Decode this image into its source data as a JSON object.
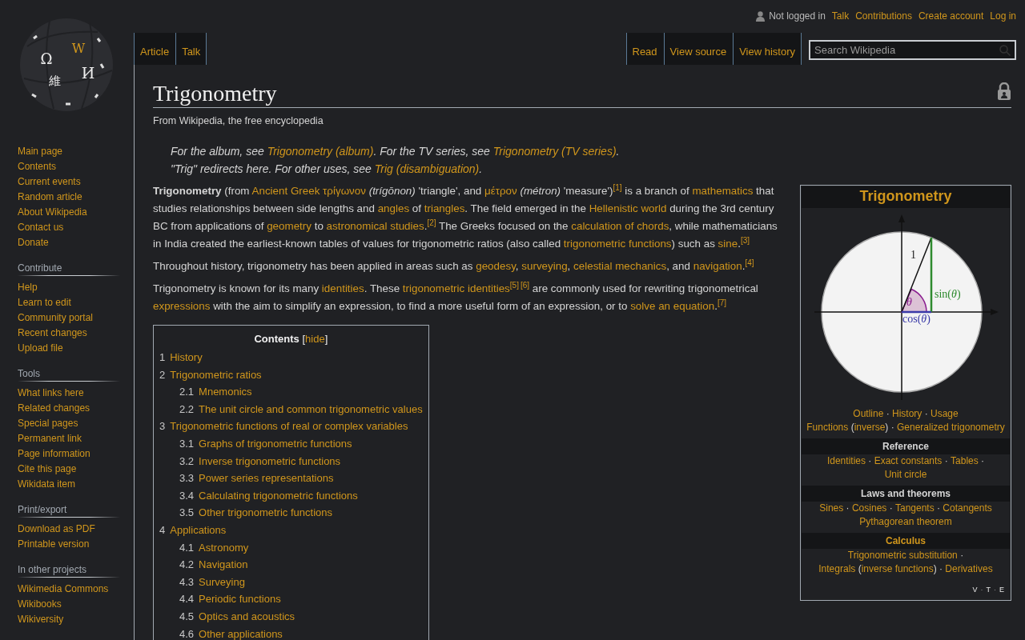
{
  "logo": {
    "glyphs": [
      "W",
      "Ω",
      "維",
      "И"
    ]
  },
  "personal": {
    "status": "Not logged in",
    "links": [
      "Talk",
      "Contributions",
      "Create account",
      "Log in"
    ]
  },
  "sidebar": [
    {
      "items": [
        "Main page",
        "Contents",
        "Current events",
        "Random article",
        "About Wikipedia",
        "Contact us",
        "Donate"
      ]
    },
    {
      "heading": "Contribute",
      "items": [
        "Help",
        "Learn to edit",
        "Community portal",
        "Recent changes",
        "Upload file"
      ]
    },
    {
      "heading": "Tools",
      "items": [
        "What links here",
        "Related changes",
        "Special pages",
        "Permanent link",
        "Page information",
        "Cite this page",
        "Wikidata item"
      ]
    },
    {
      "heading": "Print/export",
      "items": [
        "Download as PDF",
        "Printable version"
      ]
    },
    {
      "heading": "In other projects",
      "items": [
        "Wikimedia Commons",
        "Wikibooks",
        "Wikiversity"
      ]
    }
  ],
  "left_tabs": [
    "Article",
    "Talk"
  ],
  "right_tabs": [
    "Read",
    "View source",
    "View history"
  ],
  "search": {
    "placeholder": "Search Wikipedia"
  },
  "title": "Trigonometry",
  "tagline": "From Wikipedia, the free encyclopedia",
  "hatnotes": [
    [
      {
        "kind": "text",
        "text": "For the album, see "
      },
      {
        "kind": "link",
        "text": "Trigonometry (album)"
      },
      {
        "kind": "text",
        "text": ". For the TV series, see "
      },
      {
        "kind": "link",
        "text": "Trigonometry (TV series)"
      },
      {
        "kind": "text",
        "text": "."
      }
    ],
    [
      {
        "kind": "text",
        "text": "\"Trig\" redirects here. For other uses, see "
      },
      {
        "kind": "link",
        "text": "Trig (disambiguation)"
      },
      {
        "kind": "text",
        "text": "."
      }
    ]
  ],
  "paragraphs": [
    [
      {
        "kind": "bold",
        "text": "Trigonometry"
      },
      {
        "kind": "text",
        "text": " (from "
      },
      {
        "kind": "link",
        "text": "Ancient Greek τρίγωνον"
      },
      {
        "kind": "italic",
        "text": " (trígōnon)"
      },
      {
        "kind": "text",
        "text": " 'triangle', and "
      },
      {
        "kind": "link",
        "text": "μέτρον"
      },
      {
        "kind": "italic",
        "text": " (métron)"
      },
      {
        "kind": "text",
        "text": " 'measure')"
      },
      {
        "kind": "ref",
        "text": "[1]"
      },
      {
        "kind": "text",
        "text": " is a branch of "
      },
      {
        "kind": "link",
        "text": "mathematics"
      },
      {
        "kind": "text",
        "text": " that studies relationships between side lengths and "
      },
      {
        "kind": "link",
        "text": "angles"
      },
      {
        "kind": "text",
        "text": " of "
      },
      {
        "kind": "link",
        "text": "triangles"
      },
      {
        "kind": "text",
        "text": ". The field emerged in the "
      },
      {
        "kind": "link",
        "text": "Hellenistic world"
      },
      {
        "kind": "text",
        "text": " during the 3rd century BC from applications of "
      },
      {
        "kind": "link",
        "text": "geometry"
      },
      {
        "kind": "text",
        "text": " to "
      },
      {
        "kind": "link",
        "text": "astronomical studies"
      },
      {
        "kind": "text",
        "text": "."
      },
      {
        "kind": "ref",
        "text": "[2]"
      },
      {
        "kind": "text",
        "text": " The Greeks focused on the "
      },
      {
        "kind": "link",
        "text": "calculation of chords"
      },
      {
        "kind": "text",
        "text": ", while mathematicians in India created the earliest-known tables of values for trigonometric ratios (also called "
      },
      {
        "kind": "link",
        "text": "trigonometric functions"
      },
      {
        "kind": "text",
        "text": ") such as "
      },
      {
        "kind": "link",
        "text": "sine"
      },
      {
        "kind": "text",
        "text": "."
      },
      {
        "kind": "ref",
        "text": "[3]"
      }
    ],
    [
      {
        "kind": "text",
        "text": "Throughout history, trigonometry has been applied in areas such as "
      },
      {
        "kind": "link",
        "text": "geodesy"
      },
      {
        "kind": "text",
        "text": ", "
      },
      {
        "kind": "link",
        "text": "surveying"
      },
      {
        "kind": "text",
        "text": ", "
      },
      {
        "kind": "link",
        "text": "celestial mechanics"
      },
      {
        "kind": "text",
        "text": ", and "
      },
      {
        "kind": "link",
        "text": "navigation"
      },
      {
        "kind": "text",
        "text": "."
      },
      {
        "kind": "ref",
        "text": "[4]"
      }
    ],
    [
      {
        "kind": "text",
        "text": "Trigonometry is known for its many "
      },
      {
        "kind": "link",
        "text": "identities"
      },
      {
        "kind": "text",
        "text": ". These "
      },
      {
        "kind": "link",
        "text": "trigonometric identities"
      },
      {
        "kind": "ref",
        "text": "[5]"
      },
      {
        "kind": "ref",
        "text": "[6]"
      },
      {
        "kind": "text",
        "text": " are commonly used for rewriting trigonometrical "
      },
      {
        "kind": "link",
        "text": "expressions"
      },
      {
        "kind": "text",
        "text": " with the aim to simplify an expression, to find a more useful form of an expression, or to "
      },
      {
        "kind": "link",
        "text": "solve an equation"
      },
      {
        "kind": "text",
        "text": "."
      },
      {
        "kind": "ref",
        "text": "[7]"
      }
    ]
  ],
  "toc": {
    "title": "Contents",
    "toggle": {
      "before": "[",
      "label": "hide",
      "after": "]"
    },
    "items": [
      {
        "number": "1",
        "label": "History"
      },
      {
        "number": "2",
        "label": "Trigonometric ratios",
        "children": [
          {
            "number": "2.1",
            "label": "Mnemonics"
          },
          {
            "number": "2.2",
            "label": "The unit circle and common trigonometric values"
          }
        ]
      },
      {
        "number": "3",
        "label": "Trigonometric functions of real or complex variables",
        "children": [
          {
            "number": "3.1",
            "label": "Graphs of trigonometric functions"
          },
          {
            "number": "3.2",
            "label": "Inverse trigonometric functions"
          },
          {
            "number": "3.3",
            "label": "Power series representations"
          },
          {
            "number": "3.4",
            "label": "Calculating trigonometric functions"
          },
          {
            "number": "3.5",
            "label": "Other trigonometric functions"
          }
        ]
      },
      {
        "number": "4",
        "label": "Applications",
        "children": [
          {
            "number": "4.1",
            "label": "Astronomy"
          },
          {
            "number": "4.2",
            "label": "Navigation"
          },
          {
            "number": "4.3",
            "label": "Surveying"
          },
          {
            "number": "4.4",
            "label": "Periodic functions"
          },
          {
            "number": "4.5",
            "label": "Optics and acoustics"
          },
          {
            "number": "4.6",
            "label": "Other applications"
          }
        ]
      }
    ]
  },
  "infobox": {
    "title": "Trigonometry",
    "diagram_labels": [
      {
        "kind": "radius",
        "text": "1"
      },
      {
        "kind": "angle",
        "text": "*θ*"
      },
      {
        "kind": "sine",
        "text": "sin(*θ*)"
      },
      {
        "kind": "cosine",
        "text": "cos(*θ*)"
      }
    ],
    "sections": [
      {
        "lines": [
          {
            "segments": [
              {
                "kind": "link",
                "text": "Outline"
              },
              {
                "kind": "text",
                "text": " · "
              },
              {
                "kind": "link",
                "text": "History"
              },
              {
                "kind": "text",
                "text": " · "
              },
              {
                "kind": "link",
                "text": "Usage"
              }
            ]
          },
          {
            "segments": [
              {
                "kind": "link",
                "text": "Functions"
              },
              {
                "kind": "text",
                "text": " ("
              },
              {
                "kind": "link",
                "text": "inverse"
              },
              {
                "kind": "text",
                "text": ") · "
              },
              {
                "kind": "link",
                "text": "Generalized trigonometry"
              }
            ]
          }
        ]
      },
      {
        "heading": "Reference",
        "kind": "plain",
        "lines": [
          {
            "segments": [
              {
                "kind": "link",
                "text": "Identities"
              },
              {
                "kind": "text",
                "text": " · "
              },
              {
                "kind": "link",
                "text": "Exact constants"
              },
              {
                "kind": "text",
                "text": " · "
              },
              {
                "kind": "link",
                "text": "Tables"
              },
              {
                "kind": "text",
                "text": " ·"
              }
            ]
          },
          {
            "segments": [
              {
                "kind": "link",
                "text": "Unit circle"
              }
            ]
          }
        ]
      },
      {
        "heading": "Laws and theorems",
        "kind": "plain",
        "lines": [
          {
            "segments": [
              {
                "kind": "link",
                "text": "Sines"
              },
              {
                "kind": "text",
                "text": " · "
              },
              {
                "kind": "link",
                "text": "Cosines"
              },
              {
                "kind": "text",
                "text": " · "
              },
              {
                "kind": "link",
                "text": "Tangents"
              },
              {
                "kind": "text",
                "text": " · "
              },
              {
                "kind": "link",
                "text": "Cotangents"
              }
            ]
          },
          {
            "segments": [
              {
                "kind": "link",
                "text": "Pythagorean theorem"
              }
            ]
          }
        ]
      },
      {
        "heading": "Calculus",
        "kind": "link",
        "lines": [
          {
            "segments": [
              {
                "kind": "link",
                "text": "Trigonometric substitution"
              },
              {
                "kind": "text",
                "text": " ·"
              }
            ]
          },
          {
            "segments": [
              {
                "kind": "link",
                "text": "Integrals"
              },
              {
                "kind": "text",
                "text": " ("
              },
              {
                "kind": "link",
                "text": "inverse functions"
              },
              {
                "kind": "text",
                "text": ") · "
              },
              {
                "kind": "link",
                "text": "Derivatives"
              }
            ]
          }
        ]
      }
    ],
    "footer": [
      {
        "kind": "link",
        "text": "V"
      },
      {
        "kind": "text",
        "text": "·"
      },
      {
        "kind": "link",
        "text": "T"
      },
      {
        "kind": "text",
        "text": "·"
      },
      {
        "kind": "link",
        "text": "E"
      }
    ]
  }
}
